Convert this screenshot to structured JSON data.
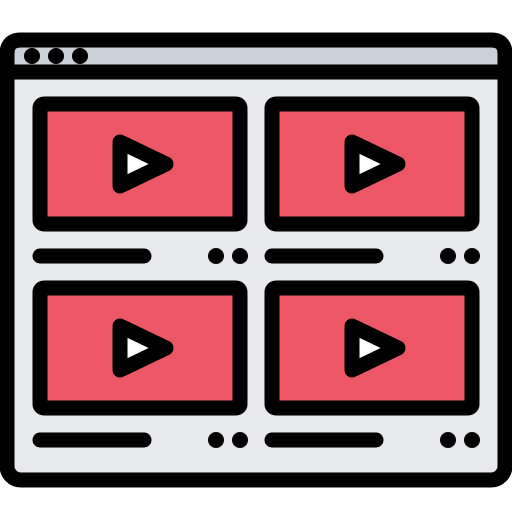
{
  "colors": {
    "outline": "#000000",
    "window_body": "#e7e9ed",
    "title_bar": "#ccd0d9",
    "video_thumbnail": "#ee5766",
    "play_triangle": "#ffffff",
    "page_background": "#ffffff"
  },
  "window": {
    "controls": [
      "window-dot-icon",
      "window-dot-icon",
      "window-dot-icon"
    ]
  },
  "video_grid": {
    "items": [
      {
        "icon": "play-icon",
        "caption_bar": "line",
        "menu": "dots-icon"
      },
      {
        "icon": "play-icon",
        "caption_bar": "line",
        "menu": "dots-icon"
      },
      {
        "icon": "play-icon",
        "caption_bar": "line",
        "menu": "dots-icon"
      },
      {
        "icon": "play-icon",
        "caption_bar": "line",
        "menu": "dots-icon"
      }
    ]
  }
}
